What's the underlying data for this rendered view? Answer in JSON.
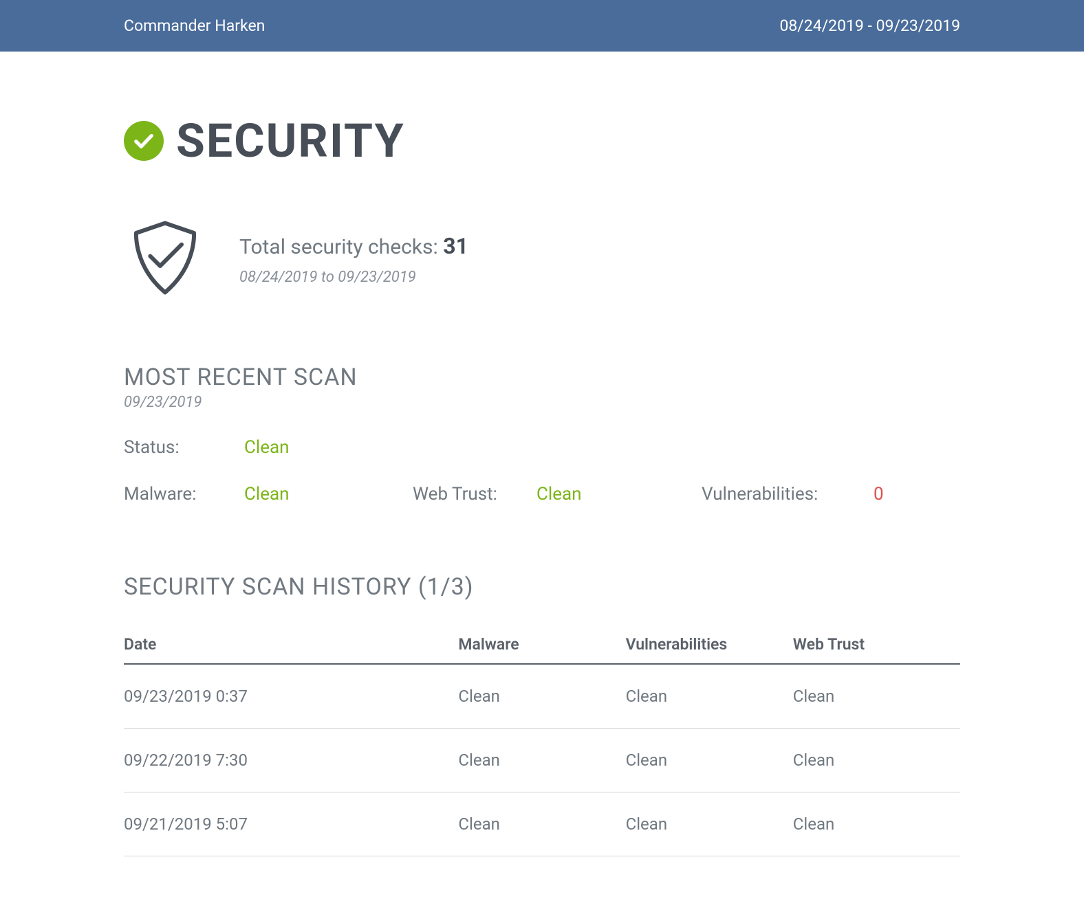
{
  "header": {
    "user_name": "Commander Harken",
    "date_range": "08/24/2019 - 09/23/2019"
  },
  "title": "SECURITY",
  "summary": {
    "checks_label": "Total security checks: ",
    "checks_count": "31",
    "date_range_text": "08/24/2019 to 09/23/2019"
  },
  "recent_scan": {
    "heading": "MOST RECENT SCAN",
    "date": "09/23/2019",
    "status_label": "Status:",
    "status_value": "Clean",
    "malware_label": "Malware:",
    "malware_value": "Clean",
    "webtrust_label": "Web Trust:",
    "webtrust_value": "Clean",
    "vuln_label": "Vulnerabilities:",
    "vuln_value": "0"
  },
  "history": {
    "heading": "SECURITY SCAN HISTORY (1/3)",
    "columns": {
      "date": "Date",
      "malware": "Malware",
      "vulnerabilities": "Vulnerabilities",
      "webtrust": "Web Trust"
    },
    "rows": [
      {
        "date": "09/23/2019 0:37",
        "malware": "Clean",
        "vulnerabilities": "Clean",
        "webtrust": "Clean"
      },
      {
        "date": "09/22/2019 7:30",
        "malware": "Clean",
        "vulnerabilities": "Clean",
        "webtrust": "Clean"
      },
      {
        "date": "09/21/2019 5:07",
        "malware": "Clean",
        "vulnerabilities": "Clean",
        "webtrust": "Clean"
      }
    ]
  },
  "colors": {
    "header_bg": "#4a6c9b",
    "green": "#7cb518",
    "red": "#d9534f",
    "text_dark": "#474e57",
    "text_mid": "#707880"
  }
}
